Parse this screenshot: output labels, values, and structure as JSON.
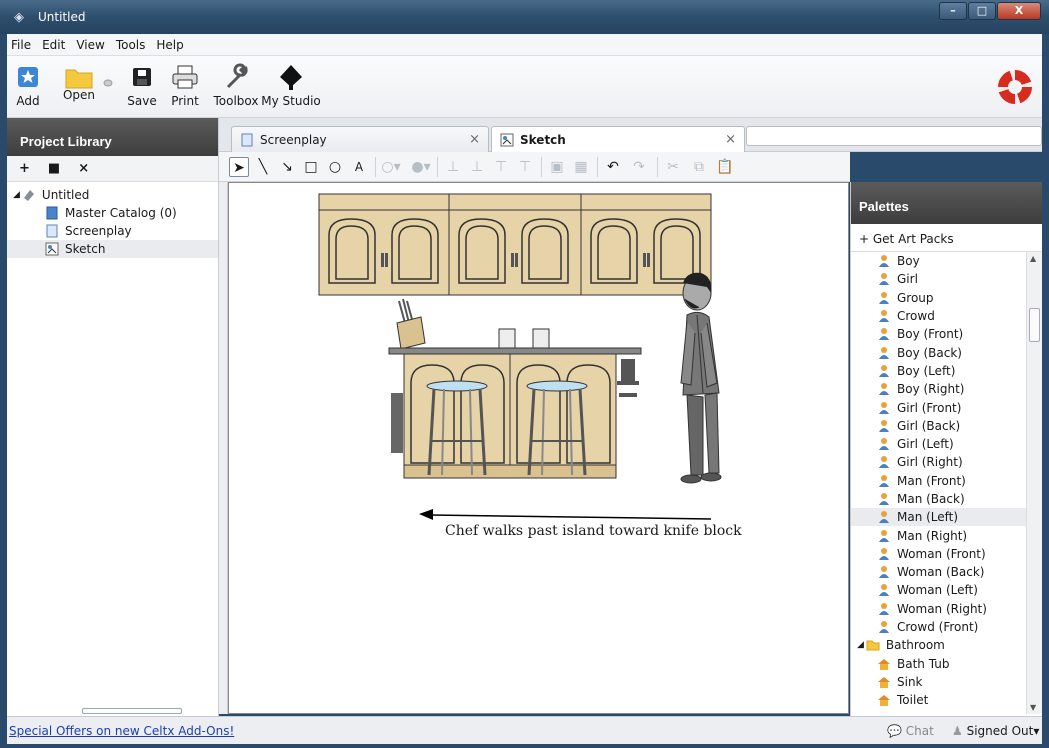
{
  "window": {
    "title": "Untitled",
    "buttons": [
      "–",
      "□",
      "X"
    ]
  },
  "menu": [
    "File",
    "Edit",
    "View",
    "Tools",
    "Help"
  ],
  "toolbar": {
    "add": "Add",
    "open": "Open",
    "save": "Save",
    "print": "Print",
    "toolbox": "Toolbox",
    "studio": "My Studio"
  },
  "project_library": {
    "title": "Project Library",
    "tools": [
      "+",
      "■",
      "×"
    ],
    "tree": [
      {
        "label": "Untitled",
        "level": 0
      },
      {
        "label": "Master Catalog (0)",
        "level": 1
      },
      {
        "label": "Screenplay",
        "level": 1
      },
      {
        "label": "Sketch",
        "level": 1,
        "selected": true
      }
    ]
  },
  "tabs": [
    {
      "label": "Screenplay",
      "close": "×"
    },
    {
      "label": "Sketch",
      "close": "×",
      "active": true
    }
  ],
  "sketch": {
    "caption": "Chef walks past island toward knife block"
  },
  "palettes": {
    "title": "Palettes",
    "get_art": "+ Get Art Packs",
    "items": [
      "Boy",
      "Girl",
      "Group",
      "Crowd",
      "Boy (Front)",
      "Boy (Back)",
      "Boy (Left)",
      "Boy (Right)",
      "Girl (Front)",
      "Girl (Back)",
      "Girl (Left)",
      "Girl (Right)",
      "Man (Front)",
      "Man (Back)",
      "Man (Left)",
      "Man (Right)",
      "Woman (Front)",
      "Woman (Back)",
      "Woman (Left)",
      "Woman (Right)",
      "Crowd (Front)"
    ],
    "selected": "Man (Left)",
    "folder": "Bathroom",
    "bathroom_items": [
      "Bath Tub",
      "Sink",
      "Toilet"
    ]
  },
  "status": {
    "offers": "Special Offers on new Celtx Add-Ons!",
    "chat": "Chat",
    "signed": "Signed Out"
  },
  "colors": {
    "accent_link": "#1a3fb5",
    "header_dark": "#3d3d3d",
    "cabinet": "#e7d3a8"
  }
}
